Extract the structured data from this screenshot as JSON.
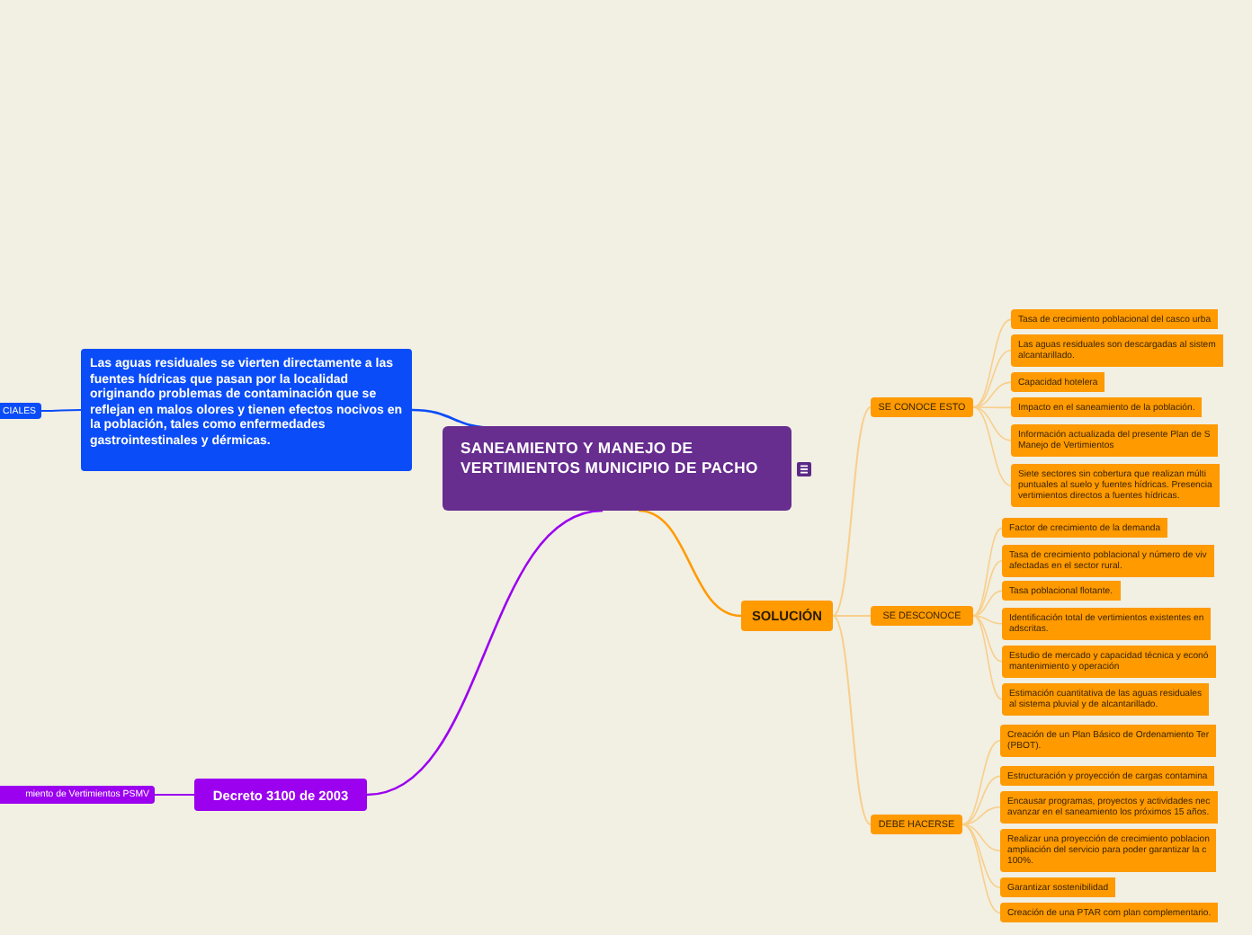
{
  "central_topic": {
    "title": "SANEAMIENTO Y MANEJO DE VERTIMIENTOS MUNICIPIO DE PACHO",
    "has_notes": true
  },
  "branches": [
    {
      "label": "Las aguas residuales se vierten directamente a las fuentes hídricas que pasan por la localidad originando problemas de contaminación que se reflejan en malos olores y tienen efectos nocivos en la población, tales como enfermedades gastrointestinales y dérmicas.",
      "color": "#0a4cf7",
      "children": [
        {
          "label": "CIALES"
        }
      ]
    },
    {
      "label": "Decreto 3100 de 2003",
      "color": "#9b00ef",
      "children": [
        {
          "label": "miento de Vertimientos PSMV"
        }
      ]
    },
    {
      "label": "SOLUCIÓN",
      "color": "#ff9a00",
      "children": [
        {
          "label": "SE CONOCE ESTO",
          "children": [
            {
              "lines": [
                "Tasa de crecimiento poblacional del casco urba"
              ]
            },
            {
              "lines": [
                "Las aguas residuales son descargadas al sistem",
                "alcantarillado."
              ]
            },
            {
              "lines": [
                "Capacidad hotelera"
              ]
            },
            {
              "lines": [
                "Impacto en el saneamiento de la población."
              ]
            },
            {
              "lines": [
                "Información actualizada del presente Plan de S",
                "Manejo de Vertimientos"
              ]
            },
            {
              "lines": [
                "Siete sectores sin cobertura que realizan múlti",
                "puntuales al suelo y fuentes hídricas. Presencia",
                "vertimientos directos a fuentes hídricas."
              ]
            }
          ]
        },
        {
          "label": "SE DESCONOCE",
          "children": [
            {
              "lines": [
                "Factor de crecimiento  de la demanda"
              ]
            },
            {
              "lines": [
                "Tasa de crecimiento poblacional y número de viv",
                "afectadas en el sector rural."
              ]
            },
            {
              "lines": [
                "Tasa poblacional flotante."
              ]
            },
            {
              "lines": [
                "Identificación total de vertimientos existentes en",
                "adscritas."
              ]
            },
            {
              "lines": [
                "Estudio de mercado y capacidad técnica y econó",
                "mantenimiento y operación"
              ]
            },
            {
              "lines": [
                "Estimación cuantitativa  de las aguas residuales",
                "al sistema pluvial y de alcantarillado."
              ]
            }
          ]
        },
        {
          "label": "DEBE HACERSE",
          "children": [
            {
              "lines": [
                "Creación de  un Plan Básico de Ordenamiento Ter",
                "(PBOT)."
              ]
            },
            {
              "lines": [
                "Estructuración y proyección de cargas contamina"
              ]
            },
            {
              "lines": [
                "Encausar programas, proyectos y actividades nec",
                "avanzar en el saneamiento los próximos 15 años."
              ]
            },
            {
              "lines": [
                "Realizar una proyección de crecimiento poblacion",
                "ampliación del servicio para poder garantizar la c",
                "100%."
              ]
            },
            {
              "lines": [
                "Garantizar sostenibilidad"
              ]
            },
            {
              "lines": [
                "Creación de una PTAR com plan complementario."
              ]
            }
          ]
        }
      ]
    }
  ]
}
